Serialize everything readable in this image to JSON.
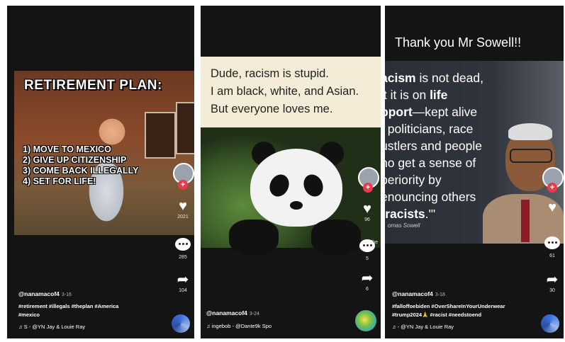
{
  "panels": [
    {
      "meme": {
        "title": "RETIREMENT PLAN:",
        "steps": [
          "1) MOVE TO MEXICO",
          "2) GIVE UP CITIZENSHIP",
          "3) COME BACK ILLEGALLY",
          "4) SET FOR LIFE!"
        ]
      },
      "likes": "2021",
      "comments": "285",
      "shares": "104",
      "username": "@nanamacof4",
      "date": "3-16",
      "hashtags_line1": "#retirement #illegals #theplan #America",
      "hashtags_line2": "#mexico",
      "sound": "S - @YN Jay & Louie Ray"
    },
    {
      "quote": [
        "Dude, racism is stupid.",
        "I am black, white, and Asian.",
        "But everyone loves me."
      ],
      "credit": "fb/The",
      "likes": "96",
      "comments": "5",
      "shares": "6",
      "username": "@nanamacof4",
      "date": "3-24",
      "sound": "ingebob - @Dante9k  Spo"
    },
    {
      "banner": "Thank you Mr Sowell!!",
      "quote_lines": [
        {
          "pre": "",
          "bold": "acism",
          "post": " is not dead,"
        },
        {
          "pre": "it it is on ",
          "bold": "life",
          "post": ""
        },
        {
          "pre": "",
          "bold": "pport",
          "post": "—kept alive"
        },
        {
          "pre": "/ politicians, race",
          "bold": "",
          "post": ""
        },
        {
          "pre": "ustlers and people",
          "bold": "",
          "post": ""
        },
        {
          "pre": "ho get a sense of",
          "bold": "",
          "post": ""
        },
        {
          "pre": "periority by",
          "bold": "",
          "post": ""
        },
        {
          "pre": "enouncing others",
          "bold": "",
          "post": ""
        },
        {
          "pre": "\"",
          "bold": "racists",
          "post": ".'\""
        }
      ],
      "quote_credit": "omas Sowell",
      "comments": "61",
      "shares": "30",
      "username": "@nanamacof4",
      "date": "3-18",
      "hashtags_line1": "#falloffoebiden #OverShareInYourUnderwear",
      "hashtags_line2": "#trump2024🙏 #racist #needstoend",
      "sound": "- @YN Jay & Louie Ray"
    }
  ],
  "icons": {
    "heart": "heart-icon",
    "comment": "comment-icon",
    "share": "share-icon",
    "music": "music-note-icon",
    "follow": "plus-icon"
  },
  "colors": {
    "panel_bg": "#141414",
    "follow_red": "#ea3a4d",
    "quote_bg": "#f4ecd6"
  }
}
